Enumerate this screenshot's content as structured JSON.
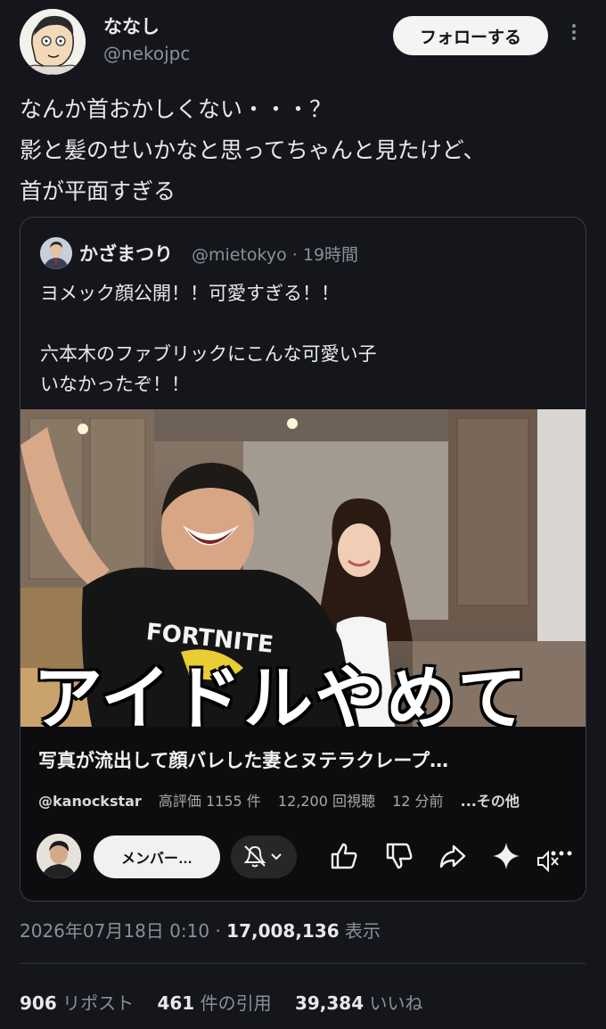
{
  "author": {
    "name": "ななし",
    "handle": "@nekojpc",
    "follow_label": "フォローする"
  },
  "tweet": {
    "lines": [
      "なんか首おかしくない・・・？",
      "影と髪のせいかなと思ってちゃんと見たけど、",
      "首が平面すぎる"
    ],
    "timestamp": "2026年07月18日 0:10",
    "separator": "·",
    "views": "17,008,136",
    "views_label": "表示"
  },
  "quoted": {
    "name": "かざまつり",
    "handle": "@mietokyo",
    "time": "· 19時間",
    "lines": [
      "ヨメック顔公開！！可愛すぎる！！",
      "",
      "六本木のファブリックにこんな可愛い子",
      "いなかったぞ！！"
    ]
  },
  "video": {
    "overlay_text": "アイドルやめて",
    "shirt_text": "FORTNITE",
    "title": "写真が流出して顔バレした妻とヌテラクレープ…",
    "channel": "@kanockstar",
    "likes": "高評価 1155 件",
    "views": "12,200 回視聴",
    "age": "12 分前",
    "more": "...その他",
    "member_label": "メンバー…"
  },
  "stats": {
    "reposts": "906",
    "reposts_label": "リポスト",
    "quotes": "461",
    "quotes_label": "件の引用",
    "likes": "39,384",
    "likes_label": "いいね"
  },
  "colors": {
    "background": "#15161c",
    "text": "#e7e9ea",
    "muted": "#8b8f96",
    "border": "#3a3d44"
  },
  "icons": [
    "more-vertical-icon",
    "bell-off-icon",
    "chevron-down-icon",
    "thumbs-up-icon",
    "thumbs-down-icon",
    "share-icon",
    "sparkle-icon",
    "mute-icon"
  ]
}
